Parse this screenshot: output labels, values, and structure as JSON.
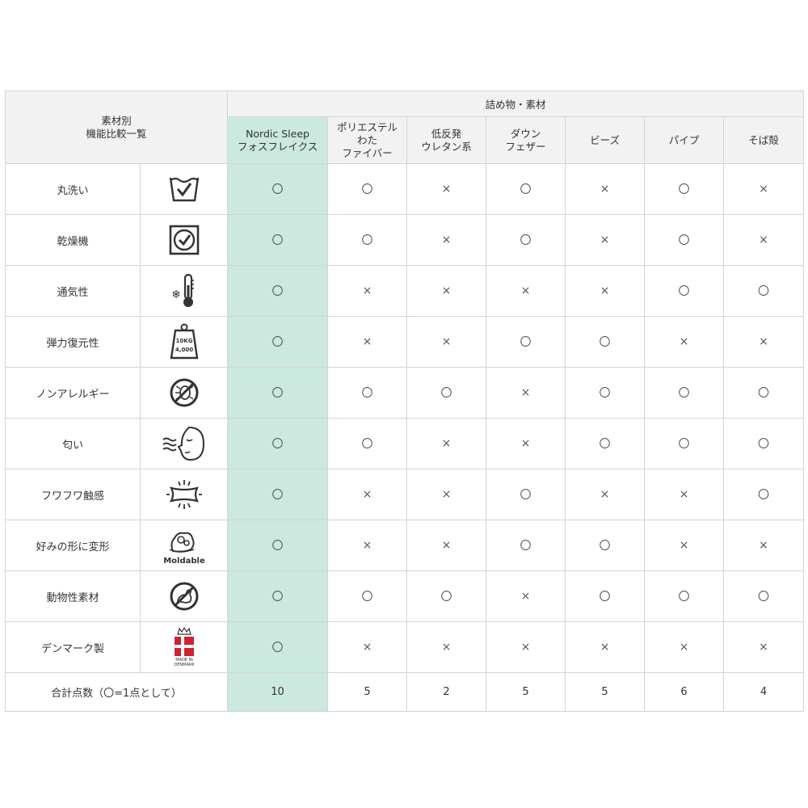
{
  "header": {
    "title": "素材別\n機能比較一覧",
    "group": "詰め物・素材",
    "columns": [
      "Nordic Sleep\nフォスフレイクス",
      "ポリエステル\nわた\nファイバー",
      "低反発\nウレタン系",
      "ダウン\nフェザー",
      "ビーズ",
      "パイプ",
      "そば殻"
    ]
  },
  "highlight_color": "#cbe9de",
  "rows": [
    {
      "label": "丸洗い",
      "icon": "washable-icon",
      "marks": [
        "〇",
        "〇",
        "×",
        "〇",
        "×",
        "〇",
        "×"
      ]
    },
    {
      "label": "乾燥機",
      "icon": "tumble-dry-icon",
      "marks": [
        "〇",
        "〇",
        "×",
        "〇",
        "×",
        "〇",
        "×"
      ]
    },
    {
      "label": "通気性",
      "icon": "thermometer-icon",
      "marks": [
        "〇",
        "×",
        "×",
        "×",
        "×",
        "〇",
        "〇"
      ]
    },
    {
      "label": "弾力復元性",
      "icon": "weight-icon",
      "icon_text": [
        "10KG",
        "4,000"
      ],
      "marks": [
        "〇",
        "×",
        "×",
        "〇",
        "〇",
        "×",
        "×"
      ]
    },
    {
      "label": "ノンアレルギー",
      "icon": "no-mite-icon",
      "marks": [
        "〇",
        "〇",
        "〇",
        "×",
        "〇",
        "〇",
        "〇"
      ]
    },
    {
      "label": "匂い",
      "icon": "smell-face-icon",
      "marks": [
        "〇",
        "〇",
        "×",
        "×",
        "〇",
        "〇",
        "〇"
      ]
    },
    {
      "label": "フワフワ触感",
      "icon": "fluffy-pillow-icon",
      "marks": [
        "〇",
        "×",
        "×",
        "〇",
        "×",
        "×",
        "〇"
      ]
    },
    {
      "label": "好みの形に変形",
      "icon": "moldable-icon",
      "icon_text": [
        "Moldable"
      ],
      "marks": [
        "〇",
        "×",
        "×",
        "〇",
        "〇",
        "×",
        "×"
      ]
    },
    {
      "label": "動物性素材",
      "icon": "no-animal-icon",
      "marks": [
        "〇",
        "〇",
        "〇",
        "×",
        "〇",
        "〇",
        "〇"
      ]
    },
    {
      "label": "デンマーク製",
      "icon": "made-in-denmark-icon",
      "icon_text": [
        "MADE IN",
        "DENMARK"
      ],
      "marks": [
        "〇",
        "×",
        "×",
        "×",
        "×",
        "×",
        "×"
      ]
    }
  ],
  "total": {
    "label": "合計点数（〇=1点として）",
    "values": [
      "10",
      "5",
      "2",
      "5",
      "5",
      "6",
      "4"
    ]
  }
}
